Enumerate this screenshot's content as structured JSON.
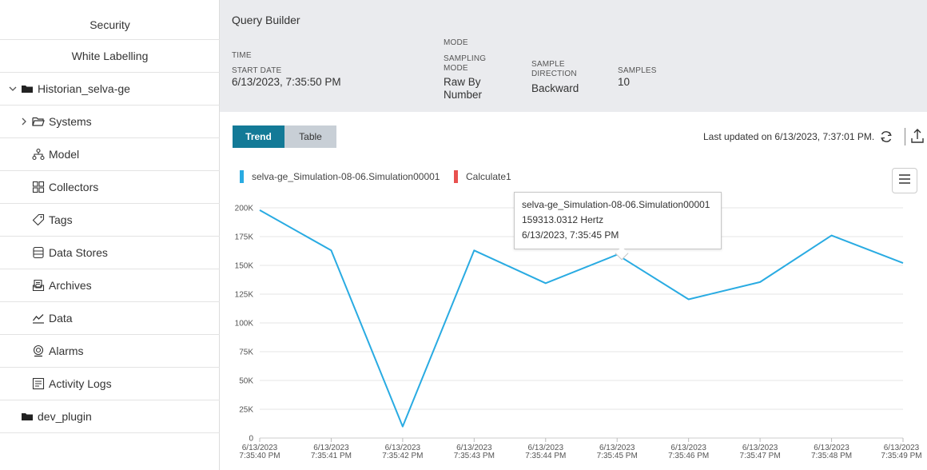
{
  "sidebar": {
    "top_items": [
      {
        "label": "Security"
      },
      {
        "label": "White Labelling"
      }
    ],
    "tree_root": {
      "label": "Historian_selva-ge",
      "icon": "folder-filled-icon",
      "expanded": true
    },
    "children": [
      {
        "label": "Systems",
        "icon": "folder-open-icon"
      },
      {
        "label": "Model",
        "icon": "model-hierarchy-icon"
      },
      {
        "label": "Collectors",
        "icon": "grid-icon"
      },
      {
        "label": "Tags",
        "icon": "tag-icon"
      },
      {
        "label": "Data Stores",
        "icon": "database-icon"
      },
      {
        "label": "Archives",
        "icon": "archive-icon"
      },
      {
        "label": "Data",
        "icon": "chart-line-icon"
      },
      {
        "label": "Alarms",
        "icon": "alarm-icon"
      },
      {
        "label": "Activity Logs",
        "icon": "activity-log-icon"
      }
    ],
    "plugin": {
      "label": "dev_plugin",
      "icon": "folder-filled-icon"
    }
  },
  "query_builder": {
    "title": "Query Builder",
    "time_label": "TIME",
    "start_date_label": "START DATE",
    "start_date_value": "6/13/2023, 7:35:50 PM",
    "mode_label": "MODE",
    "sampling_mode_label": "SAMPLING MODE",
    "sampling_mode_value": "Raw By Number",
    "sample_direction_label": "SAMPLE DIRECTION",
    "sample_direction_value": "Backward",
    "samples_label": "SAMPLES",
    "samples_value": "10"
  },
  "tabs": [
    {
      "label": "Trend",
      "active": true
    },
    {
      "label": "Table",
      "active": false
    }
  ],
  "last_updated": "Last updated on 6/13/2023, 7:37:01 PM.",
  "legend": [
    {
      "label": "selva-ge_Simulation-08-06.Simulation00001",
      "color": "#29abe2"
    },
    {
      "label": "Calculate1",
      "color": "#e8514f"
    }
  ],
  "tooltip": {
    "series": "selva-ge_Simulation-08-06.Simulation00001",
    "value": "159313.0312  Hertz",
    "time": "6/13/2023, 7:35:45 PM"
  },
  "chart_data": {
    "type": "line",
    "categories": [
      [
        "6/13/2023",
        "7:35:40 PM"
      ],
      [
        "6/13/2023",
        "7:35:41 PM"
      ],
      [
        "6/13/2023",
        "7:35:42 PM"
      ],
      [
        "6/13/2023",
        "7:35:43 PM"
      ],
      [
        "6/13/2023",
        "7:35:44 PM"
      ],
      [
        "6/13/2023",
        "7:35:45 PM"
      ],
      [
        "6/13/2023",
        "7:35:46 PM"
      ],
      [
        "6/13/2023",
        "7:35:47 PM"
      ],
      [
        "6/13/2023",
        "7:35:48 PM"
      ],
      [
        "6/13/2023",
        "7:35:49 PM"
      ]
    ],
    "series": [
      {
        "name": "selva-ge_Simulation-08-06.Simulation00001",
        "color": "#29abe2",
        "values": [
          198000,
          163000,
          10000,
          163000,
          134500,
          159313.0312,
          120500,
          135500,
          176000,
          152000
        ]
      }
    ],
    "ylim": [
      0,
      200000
    ],
    "yticks": [
      0,
      25000,
      50000,
      75000,
      100000,
      125000,
      150000,
      175000,
      200000
    ],
    "ytick_labels": [
      "0",
      "25K",
      "50K",
      "75K",
      "100K",
      "125K",
      "150K",
      "175K",
      "200K"
    ],
    "grid": true
  }
}
